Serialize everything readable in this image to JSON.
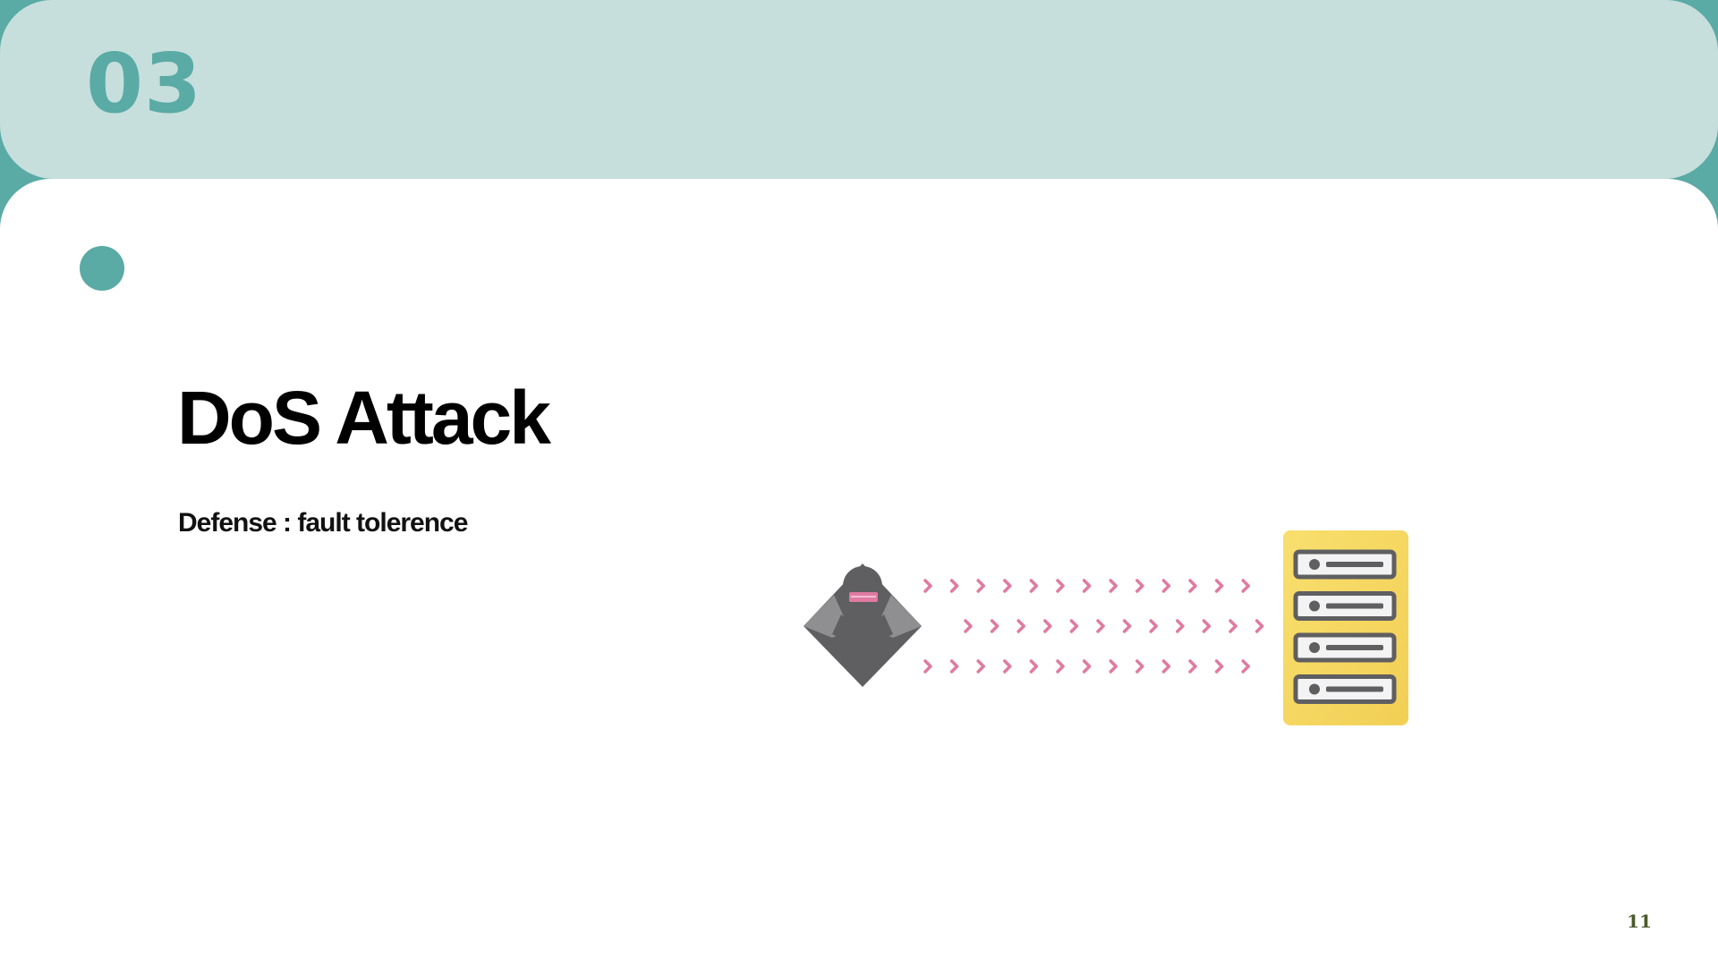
{
  "slide": {
    "section_number": "03",
    "title": "DoS Attack",
    "subtitle": "Defense : fault tolerence",
    "page_number": "11"
  },
  "colors": {
    "teal": "#5aaaa5",
    "teal_light": "#c6dfdc",
    "chevron_pink": "#e07aa0",
    "server_yellow": "#f5d45c",
    "attacker_gray": "#5f5f62"
  },
  "illustration": {
    "attacker_icon": "hacker-icon",
    "server_icon": "server-rack-icon",
    "traffic_icon": "chevron-right-icon"
  }
}
